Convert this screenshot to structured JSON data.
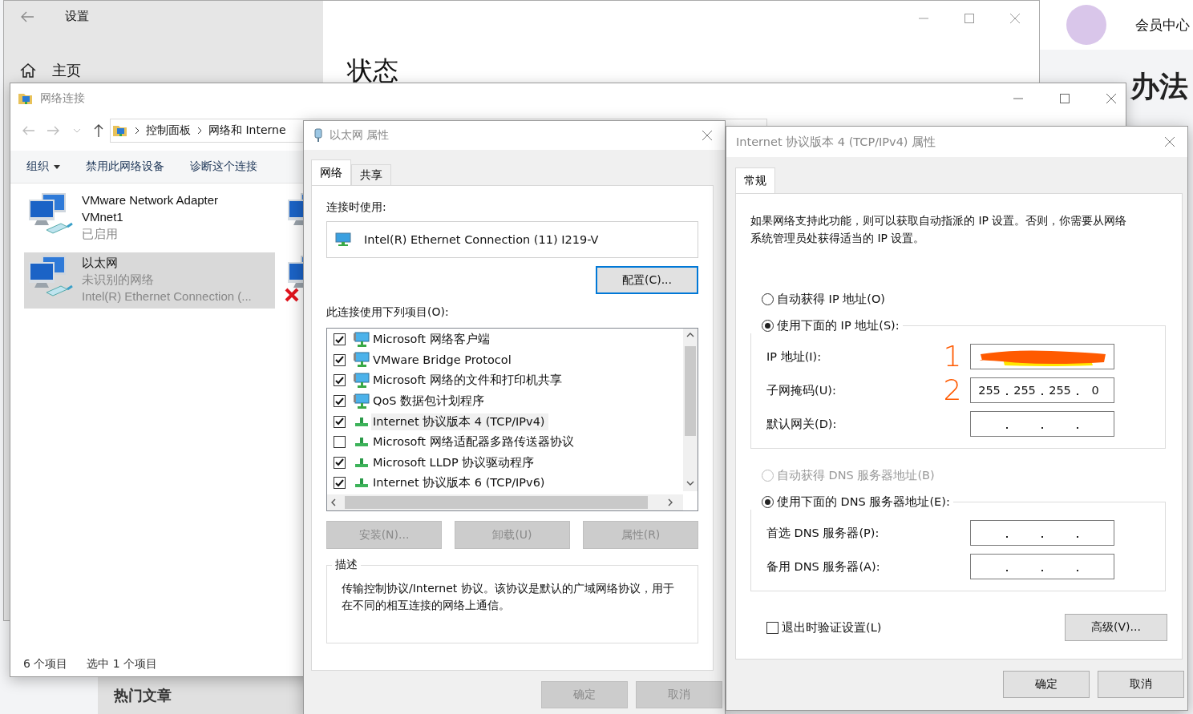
{
  "browser_page": {
    "member_center": "会员中心",
    "heading": "办法",
    "hot_articles": "热门文章"
  },
  "settings_window": {
    "title": "设置",
    "home": "主页",
    "page_title": "状态"
  },
  "network_window": {
    "title": "网络连接",
    "breadcrumb": [
      "控制面板",
      "网络和 Interne"
    ],
    "toolbar": [
      {
        "label": "组织",
        "dropdown": true
      },
      {
        "label": "禁用此网络设备",
        "dropdown": false
      },
      {
        "label": "诊断这个连接",
        "dropdown": false
      }
    ],
    "adapters": [
      {
        "name": "VMware Network Adapter VMnet1",
        "status": "已启用",
        "selected": false,
        "disconnected": false
      },
      {
        "name": "以太网",
        "status": "未识别的网络",
        "device": "Intel(R) Ethernet Connection (...",
        "selected": true,
        "disconnected": false
      },
      {
        "selected": false,
        "disconnected": false
      },
      {
        "selected": false,
        "disconnected": true
      }
    ],
    "status_bar": [
      "6 个项目",
      "选中 1 个项目"
    ]
  },
  "eth_dialog": {
    "title": "以太网 属性",
    "tabs": [
      {
        "label": "网络",
        "selected": true
      },
      {
        "label": "共享",
        "selected": false
      }
    ],
    "connect_using_label": "连接时使用:",
    "adapter": "Intel(R) Ethernet Connection (11) I219-V",
    "configure_button": "配置(C)...",
    "items_label": "此连接使用下列项目(O):",
    "items": [
      {
        "label": "Microsoft 网络客户端",
        "kind": "service",
        "checked": true,
        "selected": false
      },
      {
        "label": "VMware Bridge Protocol",
        "kind": "service",
        "checked": true,
        "selected": false
      },
      {
        "label": "Microsoft 网络的文件和打印机共享",
        "kind": "service",
        "checked": true,
        "selected": false
      },
      {
        "label": "QoS 数据包计划程序",
        "kind": "service",
        "checked": true,
        "selected": false
      },
      {
        "label": "Internet 协议版本 4 (TCP/IPv4)",
        "kind": "protocol",
        "checked": true,
        "selected": true
      },
      {
        "label": "Microsoft 网络适配器多路传送器协议",
        "kind": "protocol",
        "checked": false,
        "selected": false
      },
      {
        "label": "Microsoft LLDP 协议驱动程序",
        "kind": "protocol",
        "checked": true,
        "selected": false
      },
      {
        "label": "Internet 协议版本 6 (TCP/IPv6)",
        "kind": "protocol",
        "checked": true,
        "selected": false
      }
    ],
    "buttons": [
      {
        "label": "安装(N)...",
        "disabled": true
      },
      {
        "label": "卸载(U)",
        "disabled": true
      },
      {
        "label": "属性(R)",
        "disabled": true
      }
    ],
    "description_title": "描述",
    "description": "传输控制协议/Internet 协议。该协议是默认的广域网络协议，用于在不同的相互连接的网络上通信。",
    "footer_buttons": [
      {
        "label": "确定",
        "disabled": true
      },
      {
        "label": "取消",
        "disabled": true
      }
    ]
  },
  "ipv4_dialog": {
    "title": "Internet 协议版本 4 (TCP/IPv4) 属性",
    "tabs": [
      {
        "label": "常规",
        "selected": true
      }
    ],
    "intro": "如果网络支持此功能，则可以获取自动指派的 IP 设置。否则，你需要从网络系统管理员处获得适当的 IP 设置。",
    "ip_mode": [
      {
        "label": "自动获得 IP 地址(O)",
        "selected": false,
        "disabled": false
      },
      {
        "label": "使用下面的 IP 地址(S):",
        "selected": true,
        "disabled": false
      }
    ],
    "ip_fields": [
      {
        "label": "IP 地址(I):",
        "redacted": true,
        "annotation": "1"
      },
      {
        "label": "子网掩码(U):",
        "octets": [
          "255",
          "255",
          "255",
          "0"
        ],
        "redacted": false,
        "annotation": "2"
      },
      {
        "label": "默认网关(D):",
        "redacted": false
      }
    ],
    "dns_mode": [
      {
        "label": "自动获得 DNS 服务器地址(B)",
        "selected": false,
        "disabled": true
      },
      {
        "label": "使用下面的 DNS 服务器地址(E):",
        "selected": true,
        "disabled": false
      }
    ],
    "dns_fields": [
      {
        "label": "首选 DNS 服务器(P):",
        "redacted": false
      },
      {
        "label": "备用 DNS 服务器(A):",
        "redacted": false
      }
    ],
    "validate": {
      "label": "退出时验证设置(L)",
      "checked": false
    },
    "advanced_button": "高级(V)...",
    "footer_buttons": [
      {
        "label": "确定",
        "disabled": false
      },
      {
        "label": "取消",
        "disabled": false
      }
    ]
  }
}
